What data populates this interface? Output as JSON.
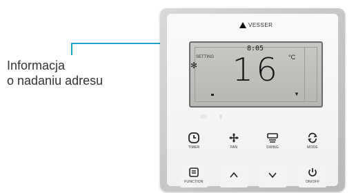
{
  "annotation": {
    "line1": "Informacja",
    "line2": "o nadaniu adresu",
    "line_color": "#1aa3d1"
  },
  "device": {
    "brand": "VESSER",
    "lcd": {
      "address": "8:05",
      "setting_label": "SETTING",
      "temperature": "16",
      "unit": "°C"
    },
    "buttons": [
      {
        "label": "TIMER",
        "icon": "clock-icon"
      },
      {
        "label": "FAN",
        "icon": "fan-icon"
      },
      {
        "label": "SWING",
        "icon": "swing-icon"
      },
      {
        "label": "MODE",
        "icon": "mode-icon"
      },
      {
        "label": "FUNCTION",
        "icon": "function-icon"
      },
      {
        "label": "",
        "icon": "chevron-up-icon"
      },
      {
        "label": "",
        "icon": "chevron-down-icon"
      },
      {
        "label": "ON/OFF",
        "icon": "power-icon"
      }
    ]
  }
}
